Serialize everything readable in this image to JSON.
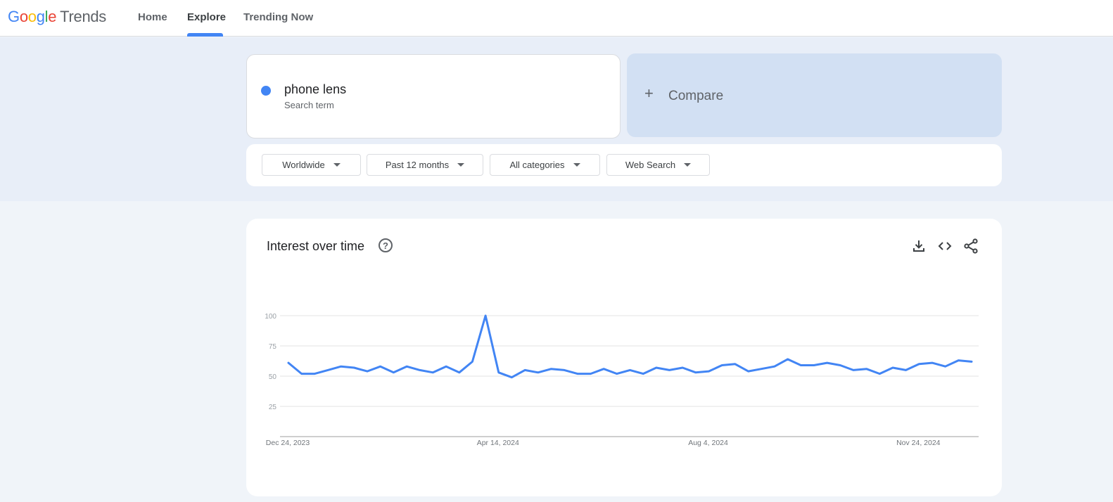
{
  "header": {
    "logo": {
      "google": [
        "G",
        "o",
        "o",
        "g",
        "l",
        "e"
      ],
      "product": "Trends"
    },
    "nav": [
      {
        "label": "Home"
      },
      {
        "label": "Explore"
      },
      {
        "label": "Trending Now"
      }
    ],
    "active_tab": "Explore"
  },
  "search": {
    "term": "phone lens",
    "subtitle": "Search term",
    "term_color": "#4285f4"
  },
  "compare": {
    "label": "Compare"
  },
  "filters": [
    {
      "label": "Worldwide"
    },
    {
      "label": "Past 12 months"
    },
    {
      "label": "All categories"
    },
    {
      "label": "Web Search"
    }
  ],
  "interest_card": {
    "title": "Interest over time",
    "icons": [
      "help-icon",
      "download-icon",
      "embed-code-icon",
      "share-icon"
    ]
  },
  "chart_data": {
    "type": "line",
    "xlabel": "",
    "ylabel": "",
    "ylim": [
      0,
      100
    ],
    "yticks": [
      25,
      50,
      75,
      100
    ],
    "grid": true,
    "x_tick_labels": [
      "Dec 24, 2023",
      "Apr 14, 2024",
      "Aug 4, 2024",
      "Nov 24, 2024"
    ],
    "x_tick_indices": [
      0,
      16,
      32,
      48
    ],
    "series": [
      {
        "color": "#4285f4",
        "values": [
          61,
          52,
          52,
          55,
          58,
          57,
          54,
          58,
          53,
          58,
          55,
          53,
          58,
          53,
          62,
          100,
          53,
          49,
          55,
          53,
          56,
          55,
          52,
          52,
          56,
          52,
          55,
          52,
          57,
          55,
          57,
          53,
          54,
          59,
          60,
          54,
          56,
          58,
          64,
          59,
          59,
          61,
          59,
          55,
          56,
          52,
          57,
          55,
          60,
          61,
          58,
          63,
          62
        ]
      }
    ]
  }
}
